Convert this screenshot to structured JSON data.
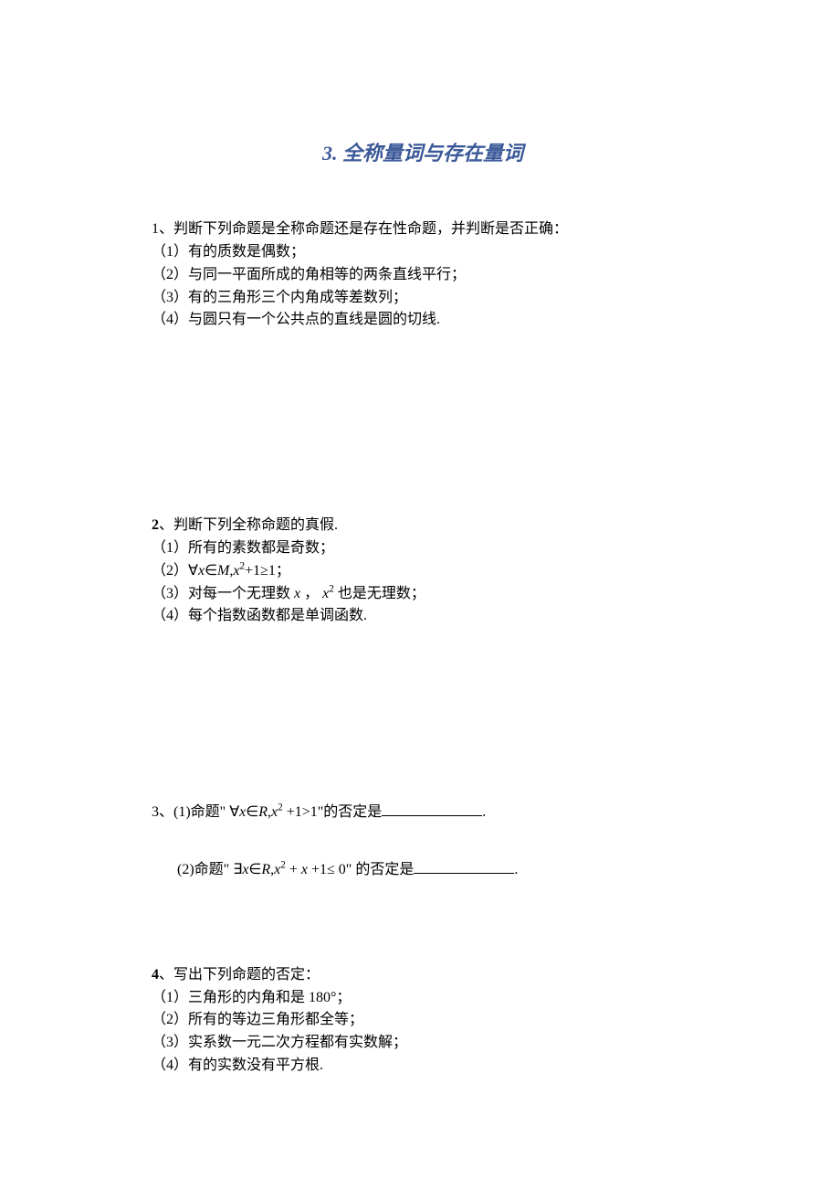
{
  "title": "3.  全称量词与存在量词",
  "q1": {
    "header": "1、判断下列命题是全称命题还是存在性命题，并判断是否正确：",
    "items": [
      "（1）有的质数是偶数；",
      "（2）与同一平面所成的角相等的两条直线平行；",
      "（3）有的三角形三个内角成等差数列；",
      "（4）与圆只有一个公共点的直线是圆的切线."
    ]
  },
  "q2": {
    "num": "2",
    "header": "、判断下列全称命题的真假.",
    "items": {
      "i1": "（1）所有的素数都是奇数；",
      "i2_prefix": "（2）",
      "i2_math_forall": "∀",
      "i2_math_x": "x",
      "i2_math_in": "∈",
      "i2_math_M": "M",
      "i2_math_comma": ",",
      "i2_math_x2": "x",
      "i2_math_sup": "2",
      "i2_math_plus": "+1≥1",
      "i2_suffix": "；",
      "i3_prefix": "（3）对每一个无理数",
      "i3_x": " x ",
      "i3_mid": "， ",
      "i3_x2": "x",
      "i3_sup": "2",
      "i3_suffix": " 也是无理数；",
      "i4": "（4）每个指数函数都是单调函数."
    }
  },
  "q3": {
    "sub1_prefix": "3、(1)命题\" ",
    "sub1_forall": "∀",
    "sub1_x": "x",
    "sub1_in": "∈",
    "sub1_R": "R",
    "sub1_comma": ",",
    "sub1_x2": "x",
    "sub1_sup": "2",
    "sub1_rest": " +1>1",
    "sub1_suffix": "\"的否定是",
    "sub1_period": ".",
    "sub2_prefix": "(2)命题\" ",
    "sub2_exists": "∃",
    "sub2_x": "x",
    "sub2_in": "∈",
    "sub2_R": "R",
    "sub2_comma": ",",
    "sub2_x2": "x",
    "sub2_sup": "2",
    "sub2_mid": " + ",
    "sub2_x3": "x",
    "sub2_rest": " +1≤ 0",
    "sub2_suffix": "\"  的否定是",
    "sub2_period": "."
  },
  "q4": {
    "num": "4",
    "header": "、写出下列命题的否定：",
    "items": [
      "（1）三角形的内角和是 180°；",
      "（2）所有的等边三角形都全等；",
      "（3）实系数一元二次方程都有实数解；",
      "（4）有的实数没有平方根."
    ]
  }
}
